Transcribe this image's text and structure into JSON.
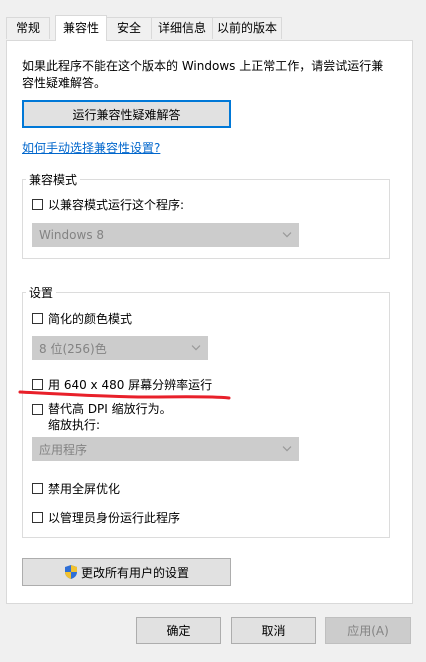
{
  "tabs": [
    {
      "label": "常规"
    },
    {
      "label": "兼容性"
    },
    {
      "label": "安全"
    },
    {
      "label": "详细信息"
    },
    {
      "label": "以前的版本"
    }
  ],
  "intro_text": "如果此程序不能在这个版本的 Windows 上正常工作，请尝试运行兼容性疑难解答。",
  "troubleshoot_button": "运行兼容性疑难解答",
  "manual_link": "如何手动选择兼容性设置?",
  "compat_mode": {
    "group_title": "兼容模式",
    "checkbox_label": "以兼容模式运行这个程序:",
    "select_value": "Windows 8"
  },
  "settings": {
    "group_title": "设置",
    "reduced_color": "简化的颜色模式",
    "color_select_value": "8 位(256)色",
    "resolution_640": "用 640 x 480 屏幕分辨率运行",
    "dpi_override_line1": "替代高 DPI 缩放行为。",
    "dpi_override_line2": "缩放执行:",
    "dpi_select_value": "应用程序",
    "disable_fullscreen": "禁用全屏优化",
    "run_as_admin": "以管理员身份运行此程序"
  },
  "change_all_users_button": "更改所有用户的设置",
  "footer": {
    "ok": "确定",
    "cancel": "取消",
    "apply": "应用(A)"
  },
  "colors": {
    "accent": "#0078d7",
    "link": "#0066cc",
    "annotation_red": "#e8202a"
  },
  "icons": {
    "shield": "uac-shield-icon",
    "dropdown": "chevron-down-icon"
  }
}
